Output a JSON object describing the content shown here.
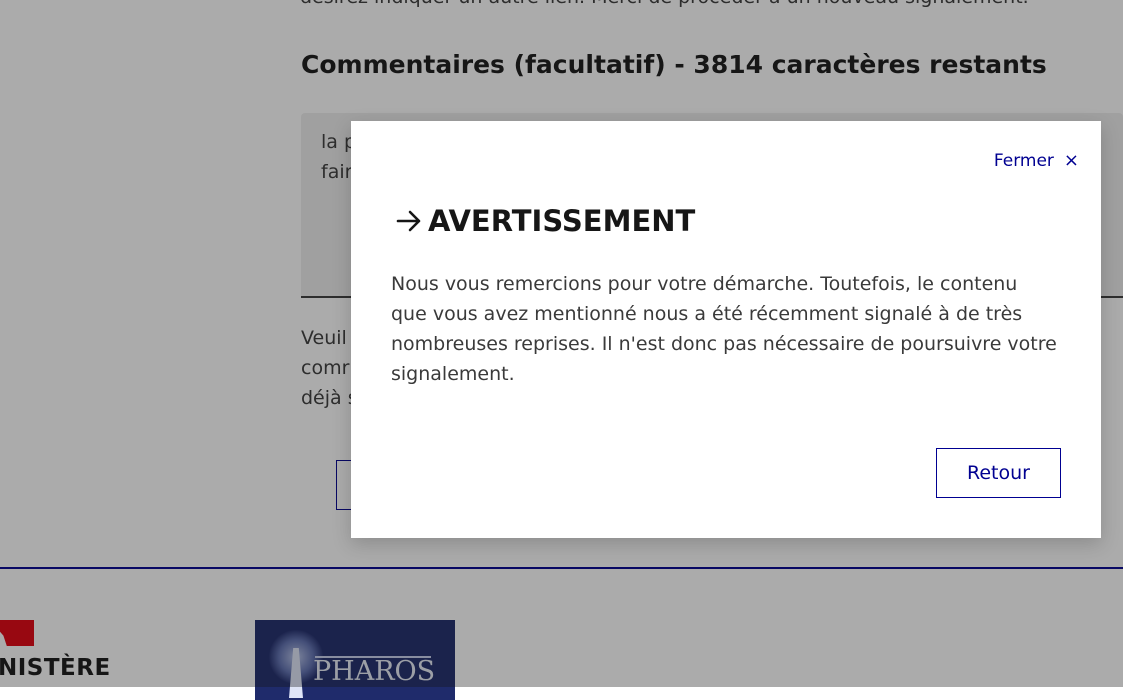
{
  "page": {
    "cut_top_text": "désirez indiquer un autre lien. Merci de procéder à un nouveau signalement.",
    "comments_heading": "Commentaires (facultatif) - 3814 caractères restants",
    "textarea_value": "la p\nfair",
    "helper_lines": [
      "Veuil",
      "comr",
      "déjà s"
    ]
  },
  "footer": {
    "ministere": "NISTÈRE",
    "pharos_logo_text": "PHAROS"
  },
  "modal": {
    "close_label": "Fermer",
    "close_icon": "×",
    "title": "AVERTISSEMENT",
    "title_icon": "arrow-right-icon",
    "body_lines": [
      "Nous vous remercions pour votre démarche. Toutefois, le contenu",
      "que vous avez mentionné nous a été récemment signalé à de très",
      "nombreuses reprises. Il n'est donc pas nécessaire de poursuivre votre",
      "signalement."
    ],
    "retour_label": "Retour"
  },
  "colors": {
    "primary_blue": "#000091",
    "marianne_red": "#e1000f",
    "overlay": "rgba(22,22,22,0.36)"
  }
}
